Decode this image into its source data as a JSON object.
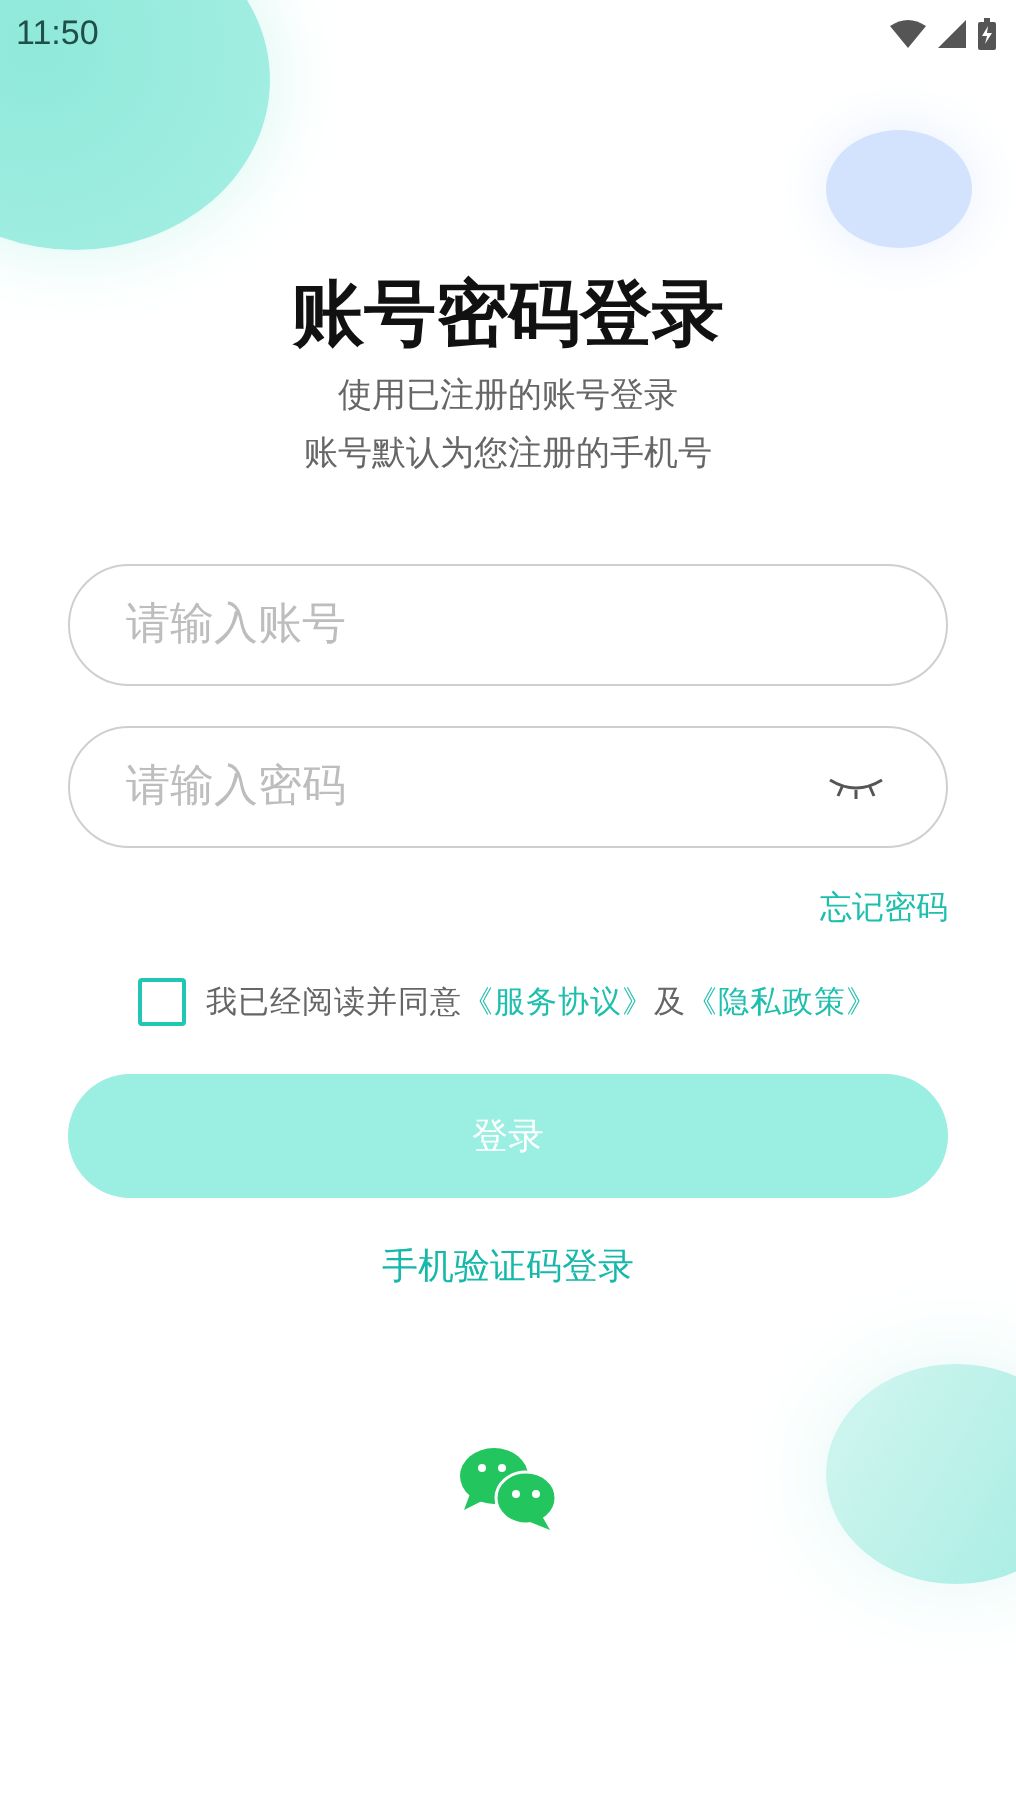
{
  "status_bar": {
    "time": "11:50"
  },
  "title": "账号密码登录",
  "subtitle_lines": [
    "使用已注册的账号登录",
    "账号默认为您注册的手机号"
  ],
  "fields": [
    {
      "kind": "text",
      "placeholder": "请输入账号"
    },
    {
      "kind": "password",
      "placeholder": "请输入密码",
      "visible": false
    }
  ],
  "forgot_link": "忘记密码",
  "agreement": {
    "checked": false,
    "text": "我已经阅读并同意",
    "links": [
      "《服务协议》",
      "《隐私政策》"
    ],
    "joiner": "及"
  },
  "login_button": {
    "label": "登录",
    "disabled": true
  },
  "sms_login_link": "手机验证码登录"
}
